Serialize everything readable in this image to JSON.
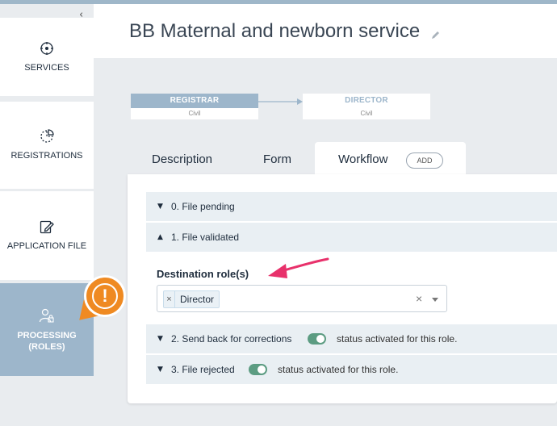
{
  "sidebar": {
    "collapse_icon": "chevron-left-icon",
    "items": [
      {
        "label": "SERVICES",
        "icon": "services-icon"
      },
      {
        "label": "REGISTRATIONS",
        "icon": "registrations-icon"
      },
      {
        "label": "APPLICATION FILE",
        "icon": "edit-file-icon"
      },
      {
        "label": "PROCESSING\n(ROLES)",
        "label_line1": "PROCESSING",
        "label_line2": "(ROLES)",
        "icon": "user-lock-icon",
        "active": true
      }
    ],
    "alert_badge": "!"
  },
  "header": {
    "title": "BB Maternal and newborn service",
    "edit_icon": "pencil-icon"
  },
  "workflow_diagram": {
    "nodes": [
      {
        "role": "REGISTRAR",
        "sub": "Civil",
        "active": true
      },
      {
        "role": "DIRECTOR",
        "sub": "Civil",
        "active": false
      }
    ]
  },
  "tabs": [
    {
      "label": "Description"
    },
    {
      "label": "Form"
    },
    {
      "label": "Workflow",
      "active": true
    }
  ],
  "add_label": "ADD",
  "steps": [
    {
      "label": "0. File pending",
      "expanded": false
    },
    {
      "label": "1. File validated",
      "expanded": true
    },
    {
      "label": "2. Send back for corrections",
      "toggle": true,
      "status": "status activated for this role."
    },
    {
      "label": "3. File rejected",
      "toggle": true,
      "status": "status activated for this role."
    }
  ],
  "destination": {
    "label": "Destination role(s)",
    "selected": [
      "Director"
    ]
  },
  "colors": {
    "accent": "#9db6cb",
    "toggle_on": "#5c9c82",
    "alert": "#ef8a22",
    "pointer": "#e8316b"
  }
}
